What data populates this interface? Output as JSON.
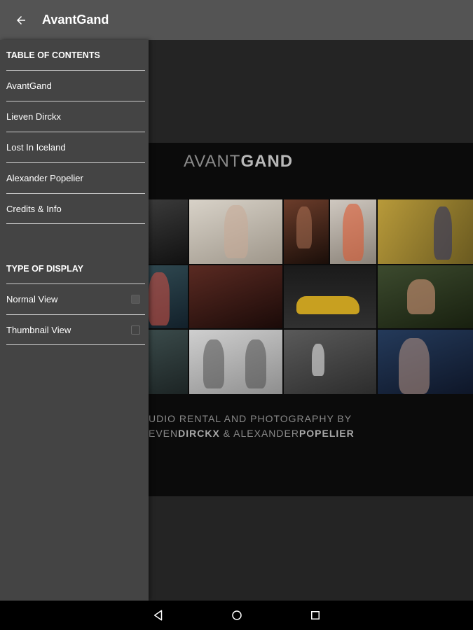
{
  "appbar": {
    "title": "AvantGand",
    "back_icon": "arrow-back-icon"
  },
  "drawer": {
    "toc_header": "TABLE OF CONTENTS",
    "toc_items": [
      {
        "label": "AvantGand"
      },
      {
        "label": "Lieven Dirckx"
      },
      {
        "label": "Lost In Iceland"
      },
      {
        "label": "Alexander Popelier"
      },
      {
        "label": "Credits & Info"
      }
    ],
    "display_header": "TYPE OF DISPLAY",
    "display_items": [
      {
        "label": "Normal View",
        "checked": true
      },
      {
        "label": "Thumbnail View",
        "checked": false
      }
    ]
  },
  "content": {
    "logo_light": "AVANT",
    "logo_bold": "GAND",
    "tagline_line1": "UDIO RENTAL AND PHOTOGRAPHY BY",
    "tagline_pre": "EVEN",
    "tagline_b1": "DIRCKX",
    "tagline_mid": " & ALEXANDER",
    "tagline_b2": "POPELIER"
  },
  "navbar": {
    "back": "nav-back-icon",
    "home": "nav-home-icon",
    "recents": "nav-recents-icon"
  },
  "colors": {
    "appbar": "#545454",
    "drawer": "#444444",
    "divider": "#c9c9c9",
    "background": "#242424"
  }
}
